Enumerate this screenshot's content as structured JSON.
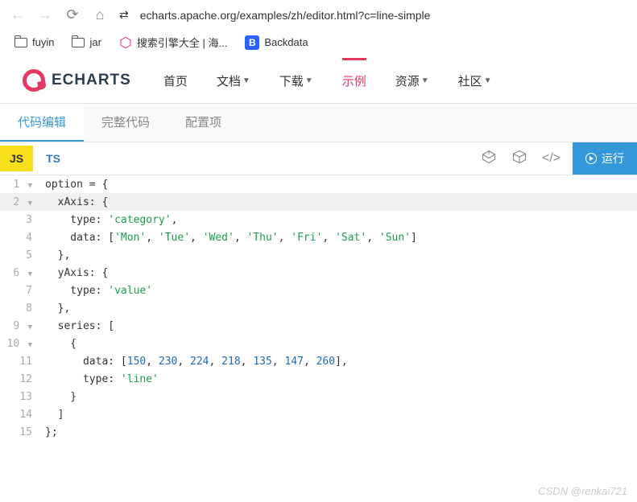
{
  "browser": {
    "url": "echarts.apache.org/examples/zh/editor.html?c=line-simple",
    "bookmarks": [
      {
        "type": "folder",
        "label": "fuyin"
      },
      {
        "type": "folder",
        "label": "jar"
      },
      {
        "type": "hex",
        "label": "搜索引擎大全 | 海..."
      },
      {
        "type": "b",
        "label": "Backdata"
      }
    ]
  },
  "header": {
    "logo_text": "ECHARTS",
    "nav": [
      {
        "label": "首页",
        "caret": false
      },
      {
        "label": "文档",
        "caret": true
      },
      {
        "label": "下载",
        "caret": true
      },
      {
        "label": "示例",
        "caret": false,
        "active": true
      },
      {
        "label": "资源",
        "caret": true
      },
      {
        "label": "社区",
        "caret": true
      }
    ]
  },
  "editor_tabs": [
    {
      "label": "代码编辑",
      "active": true
    },
    {
      "label": "完整代码"
    },
    {
      "label": "配置项"
    }
  ],
  "lang": {
    "js": "JS",
    "ts": "TS"
  },
  "run_label": "运行",
  "code_lines": [
    {
      "n": "1",
      "fold": true,
      "html": "option = {"
    },
    {
      "n": "2",
      "fold": true,
      "hl": true,
      "html": "  xAxis: {"
    },
    {
      "n": "3",
      "html": "    type: <span class='str'>'category'</span>,"
    },
    {
      "n": "4",
      "html": "    data: [<span class='str'>'Mon'</span>, <span class='str'>'Tue'</span>, <span class='str'>'Wed'</span>, <span class='str'>'Thu'</span>, <span class='str'>'Fri'</span>, <span class='str'>'Sat'</span>, <span class='str'>'Sun'</span>]"
    },
    {
      "n": "5",
      "html": "  },"
    },
    {
      "n": "6",
      "fold": true,
      "html": "  yAxis: {"
    },
    {
      "n": "7",
      "html": "    type: <span class='str'>'value'</span>"
    },
    {
      "n": "8",
      "html": "  },"
    },
    {
      "n": "9",
      "fold": true,
      "html": "  series: ["
    },
    {
      "n": "10",
      "fold": true,
      "html": "    {"
    },
    {
      "n": "11",
      "html": "      data: [<span class='num'>150</span>, <span class='num'>230</span>, <span class='num'>224</span>, <span class='num'>218</span>, <span class='num'>135</span>, <span class='num'>147</span>, <span class='num'>260</span>],"
    },
    {
      "n": "12",
      "html": "      type: <span class='str'>'line'</span>"
    },
    {
      "n": "13",
      "html": "    }"
    },
    {
      "n": "14",
      "html": "  ]"
    },
    {
      "n": "15",
      "html": "};"
    }
  ],
  "chart_data": {
    "type": "line",
    "categories": [
      "Mon",
      "Tue",
      "Wed",
      "Thu",
      "Fri",
      "Sat",
      "Sun"
    ],
    "values": [
      150,
      230,
      224,
      218,
      135,
      147,
      260
    ],
    "xAxis_type": "category",
    "yAxis_type": "value"
  },
  "watermark": "CSDN @renkai721"
}
